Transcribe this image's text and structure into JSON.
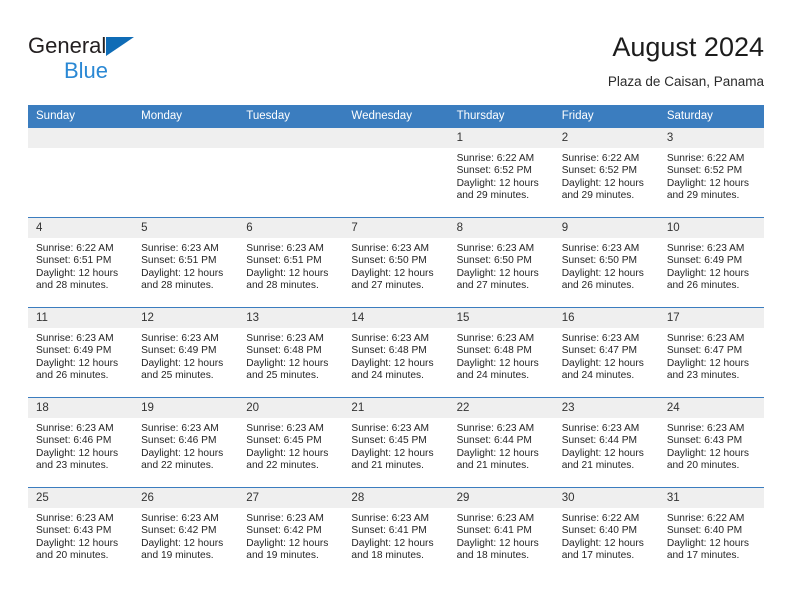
{
  "brand": {
    "name_line1": "General",
    "name_line2": "Blue",
    "triangle_color": "#0f6cb6",
    "text_color_line1": "#231f20",
    "text_color_line2": "#2a88d4"
  },
  "header": {
    "title": "August 2024",
    "subtitle": "Plaza de Caisan, Panama"
  },
  "theme": {
    "header_bg": "#3b7dbf",
    "header_text": "#ffffff",
    "daynum_bg": "#efefef",
    "row_border": "#3b7dbf",
    "body_text": "#262626"
  },
  "weekdays": [
    "Sunday",
    "Monday",
    "Tuesday",
    "Wednesday",
    "Thursday",
    "Friday",
    "Saturday"
  ],
  "weeks": [
    [
      {
        "day": "",
        "empty": true,
        "sunrise": "",
        "sunset": "",
        "daylight_line1": "",
        "daylight_line2": ""
      },
      {
        "day": "",
        "empty": true,
        "sunrise": "",
        "sunset": "",
        "daylight_line1": "",
        "daylight_line2": ""
      },
      {
        "day": "",
        "empty": true,
        "sunrise": "",
        "sunset": "",
        "daylight_line1": "",
        "daylight_line2": ""
      },
      {
        "day": "",
        "empty": true,
        "sunrise": "",
        "sunset": "",
        "daylight_line1": "",
        "daylight_line2": ""
      },
      {
        "day": "1",
        "empty": false,
        "sunrise": "Sunrise: 6:22 AM",
        "sunset": "Sunset: 6:52 PM",
        "daylight_line1": "Daylight: 12 hours",
        "daylight_line2": "and 29 minutes."
      },
      {
        "day": "2",
        "empty": false,
        "sunrise": "Sunrise: 6:22 AM",
        "sunset": "Sunset: 6:52 PM",
        "daylight_line1": "Daylight: 12 hours",
        "daylight_line2": "and 29 minutes."
      },
      {
        "day": "3",
        "empty": false,
        "sunrise": "Sunrise: 6:22 AM",
        "sunset": "Sunset: 6:52 PM",
        "daylight_line1": "Daylight: 12 hours",
        "daylight_line2": "and 29 minutes."
      }
    ],
    [
      {
        "day": "4",
        "empty": false,
        "sunrise": "Sunrise: 6:22 AM",
        "sunset": "Sunset: 6:51 PM",
        "daylight_line1": "Daylight: 12 hours",
        "daylight_line2": "and 28 minutes."
      },
      {
        "day": "5",
        "empty": false,
        "sunrise": "Sunrise: 6:23 AM",
        "sunset": "Sunset: 6:51 PM",
        "daylight_line1": "Daylight: 12 hours",
        "daylight_line2": "and 28 minutes."
      },
      {
        "day": "6",
        "empty": false,
        "sunrise": "Sunrise: 6:23 AM",
        "sunset": "Sunset: 6:51 PM",
        "daylight_line1": "Daylight: 12 hours",
        "daylight_line2": "and 28 minutes."
      },
      {
        "day": "7",
        "empty": false,
        "sunrise": "Sunrise: 6:23 AM",
        "sunset": "Sunset: 6:50 PM",
        "daylight_line1": "Daylight: 12 hours",
        "daylight_line2": "and 27 minutes."
      },
      {
        "day": "8",
        "empty": false,
        "sunrise": "Sunrise: 6:23 AM",
        "sunset": "Sunset: 6:50 PM",
        "daylight_line1": "Daylight: 12 hours",
        "daylight_line2": "and 27 minutes."
      },
      {
        "day": "9",
        "empty": false,
        "sunrise": "Sunrise: 6:23 AM",
        "sunset": "Sunset: 6:50 PM",
        "daylight_line1": "Daylight: 12 hours",
        "daylight_line2": "and 26 minutes."
      },
      {
        "day": "10",
        "empty": false,
        "sunrise": "Sunrise: 6:23 AM",
        "sunset": "Sunset: 6:49 PM",
        "daylight_line1": "Daylight: 12 hours",
        "daylight_line2": "and 26 minutes."
      }
    ],
    [
      {
        "day": "11",
        "empty": false,
        "sunrise": "Sunrise: 6:23 AM",
        "sunset": "Sunset: 6:49 PM",
        "daylight_line1": "Daylight: 12 hours",
        "daylight_line2": "and 26 minutes."
      },
      {
        "day": "12",
        "empty": false,
        "sunrise": "Sunrise: 6:23 AM",
        "sunset": "Sunset: 6:49 PM",
        "daylight_line1": "Daylight: 12 hours",
        "daylight_line2": "and 25 minutes."
      },
      {
        "day": "13",
        "empty": false,
        "sunrise": "Sunrise: 6:23 AM",
        "sunset": "Sunset: 6:48 PM",
        "daylight_line1": "Daylight: 12 hours",
        "daylight_line2": "and 25 minutes."
      },
      {
        "day": "14",
        "empty": false,
        "sunrise": "Sunrise: 6:23 AM",
        "sunset": "Sunset: 6:48 PM",
        "daylight_line1": "Daylight: 12 hours",
        "daylight_line2": "and 24 minutes."
      },
      {
        "day": "15",
        "empty": false,
        "sunrise": "Sunrise: 6:23 AM",
        "sunset": "Sunset: 6:48 PM",
        "daylight_line1": "Daylight: 12 hours",
        "daylight_line2": "and 24 minutes."
      },
      {
        "day": "16",
        "empty": false,
        "sunrise": "Sunrise: 6:23 AM",
        "sunset": "Sunset: 6:47 PM",
        "daylight_line1": "Daylight: 12 hours",
        "daylight_line2": "and 24 minutes."
      },
      {
        "day": "17",
        "empty": false,
        "sunrise": "Sunrise: 6:23 AM",
        "sunset": "Sunset: 6:47 PM",
        "daylight_line1": "Daylight: 12 hours",
        "daylight_line2": "and 23 minutes."
      }
    ],
    [
      {
        "day": "18",
        "empty": false,
        "sunrise": "Sunrise: 6:23 AM",
        "sunset": "Sunset: 6:46 PM",
        "daylight_line1": "Daylight: 12 hours",
        "daylight_line2": "and 23 minutes."
      },
      {
        "day": "19",
        "empty": false,
        "sunrise": "Sunrise: 6:23 AM",
        "sunset": "Sunset: 6:46 PM",
        "daylight_line1": "Daylight: 12 hours",
        "daylight_line2": "and 22 minutes."
      },
      {
        "day": "20",
        "empty": false,
        "sunrise": "Sunrise: 6:23 AM",
        "sunset": "Sunset: 6:45 PM",
        "daylight_line1": "Daylight: 12 hours",
        "daylight_line2": "and 22 minutes."
      },
      {
        "day": "21",
        "empty": false,
        "sunrise": "Sunrise: 6:23 AM",
        "sunset": "Sunset: 6:45 PM",
        "daylight_line1": "Daylight: 12 hours",
        "daylight_line2": "and 21 minutes."
      },
      {
        "day": "22",
        "empty": false,
        "sunrise": "Sunrise: 6:23 AM",
        "sunset": "Sunset: 6:44 PM",
        "daylight_line1": "Daylight: 12 hours",
        "daylight_line2": "and 21 minutes."
      },
      {
        "day": "23",
        "empty": false,
        "sunrise": "Sunrise: 6:23 AM",
        "sunset": "Sunset: 6:44 PM",
        "daylight_line1": "Daylight: 12 hours",
        "daylight_line2": "and 21 minutes."
      },
      {
        "day": "24",
        "empty": false,
        "sunrise": "Sunrise: 6:23 AM",
        "sunset": "Sunset: 6:43 PM",
        "daylight_line1": "Daylight: 12 hours",
        "daylight_line2": "and 20 minutes."
      }
    ],
    [
      {
        "day": "25",
        "empty": false,
        "sunrise": "Sunrise: 6:23 AM",
        "sunset": "Sunset: 6:43 PM",
        "daylight_line1": "Daylight: 12 hours",
        "daylight_line2": "and 20 minutes."
      },
      {
        "day": "26",
        "empty": false,
        "sunrise": "Sunrise: 6:23 AM",
        "sunset": "Sunset: 6:42 PM",
        "daylight_line1": "Daylight: 12 hours",
        "daylight_line2": "and 19 minutes."
      },
      {
        "day": "27",
        "empty": false,
        "sunrise": "Sunrise: 6:23 AM",
        "sunset": "Sunset: 6:42 PM",
        "daylight_line1": "Daylight: 12 hours",
        "daylight_line2": "and 19 minutes."
      },
      {
        "day": "28",
        "empty": false,
        "sunrise": "Sunrise: 6:23 AM",
        "sunset": "Sunset: 6:41 PM",
        "daylight_line1": "Daylight: 12 hours",
        "daylight_line2": "and 18 minutes."
      },
      {
        "day": "29",
        "empty": false,
        "sunrise": "Sunrise: 6:23 AM",
        "sunset": "Sunset: 6:41 PM",
        "daylight_line1": "Daylight: 12 hours",
        "daylight_line2": "and 18 minutes."
      },
      {
        "day": "30",
        "empty": false,
        "sunrise": "Sunrise: 6:22 AM",
        "sunset": "Sunset: 6:40 PM",
        "daylight_line1": "Daylight: 12 hours",
        "daylight_line2": "and 17 minutes."
      },
      {
        "day": "31",
        "empty": false,
        "sunrise": "Sunrise: 6:22 AM",
        "sunset": "Sunset: 6:40 PM",
        "daylight_line1": "Daylight: 12 hours",
        "daylight_line2": "and 17 minutes."
      }
    ]
  ]
}
